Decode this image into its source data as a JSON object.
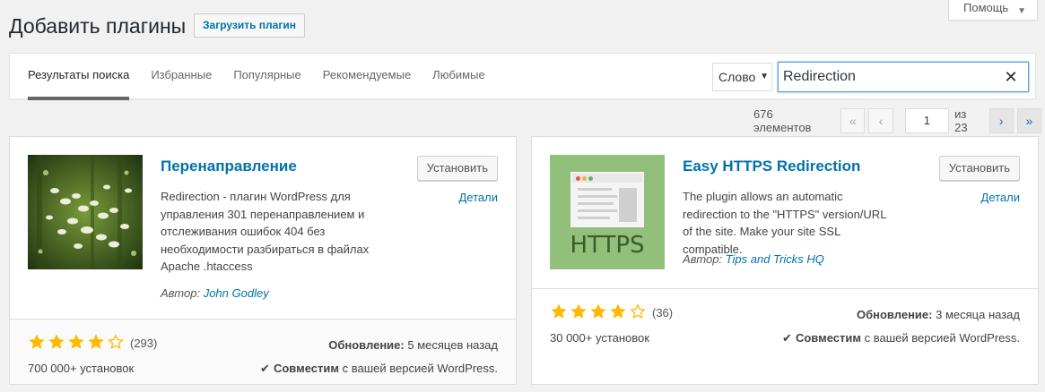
{
  "header": {
    "title": "Добавить плагины",
    "upload_label": "Загрузить плагин",
    "help_label": "Помощь"
  },
  "tabs": [
    {
      "label": "Результаты поиска",
      "active": true
    },
    {
      "label": "Избранные"
    },
    {
      "label": "Популярные"
    },
    {
      "label": "Рекомендуемые"
    },
    {
      "label": "Любимые"
    }
  ],
  "search": {
    "type_value": "Слово",
    "query": "Redirection"
  },
  "pagination": {
    "count_text": "676 элементов",
    "first": "«",
    "prev": "‹",
    "current_page": "1",
    "of_text": "из 23",
    "next": "›",
    "last": "»"
  },
  "plugins": [
    {
      "name": "Перенаправление",
      "description": "Redirection - плагин WordPress для управления 301 перенаправлением и отслеживания ошибок 404 без необходимости разбираться в файлах Apache .htaccess",
      "author_prefix": "Автор:",
      "author": "John Godley",
      "install_label": "Установить",
      "details_label": "Детали",
      "rating": 4,
      "rating_count": "(293)",
      "installs": "700 000+ установок",
      "updated_label": "Обновление:",
      "updated_value": "5 месяцев назад",
      "compat_bold": "Совместим",
      "compat_rest": "с вашей версией WordPress."
    },
    {
      "name": "Easy HTTPS Redirection",
      "description": "The plugin allows an automatic redirection to the \"HTTPS\" version/URL of the site. Make your site SSL compatible.",
      "author_prefix": "Автор:",
      "author": "Tips and Tricks HQ",
      "install_label": "Установить",
      "details_label": "Детали",
      "rating": 4,
      "rating_count": "(36)",
      "installs": "30 000+ установок",
      "updated_label": "Обновление:",
      "updated_value": "3 месяца назад",
      "compat_bold": "Совместим",
      "compat_rest": "с вашей версией WordPress.",
      "thumb_text": "HTTPS"
    }
  ],
  "colors": {
    "link": "#0073aa",
    "star": "#ffb900",
    "https_bg": "#92c07b"
  }
}
